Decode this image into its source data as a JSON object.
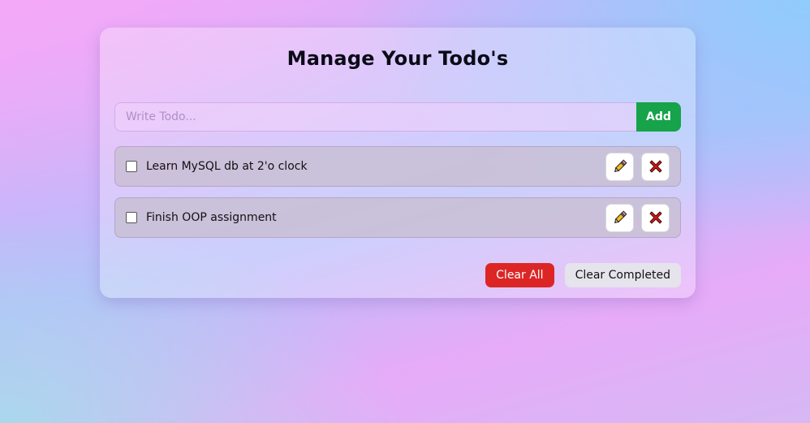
{
  "app": {
    "title": "Manage Your Todo's"
  },
  "input": {
    "placeholder": "Write Todo...",
    "value": "",
    "add_label": "Add"
  },
  "todos": [
    {
      "text": "Learn MySQL db at 2'o clock",
      "completed": false,
      "edit_icon": "pencil-icon",
      "delete_icon": "cross-mark-icon"
    },
    {
      "text": "Finish OOP assignment",
      "completed": false,
      "edit_icon": "pencil-icon",
      "delete_icon": "cross-mark-icon"
    }
  ],
  "footer": {
    "clear_all_label": "Clear All",
    "clear_completed_label": "Clear Completed"
  },
  "colors": {
    "add_button": "#16a34a",
    "clear_all_button": "#dc2626",
    "clear_completed_button": "#e5e3ec"
  }
}
